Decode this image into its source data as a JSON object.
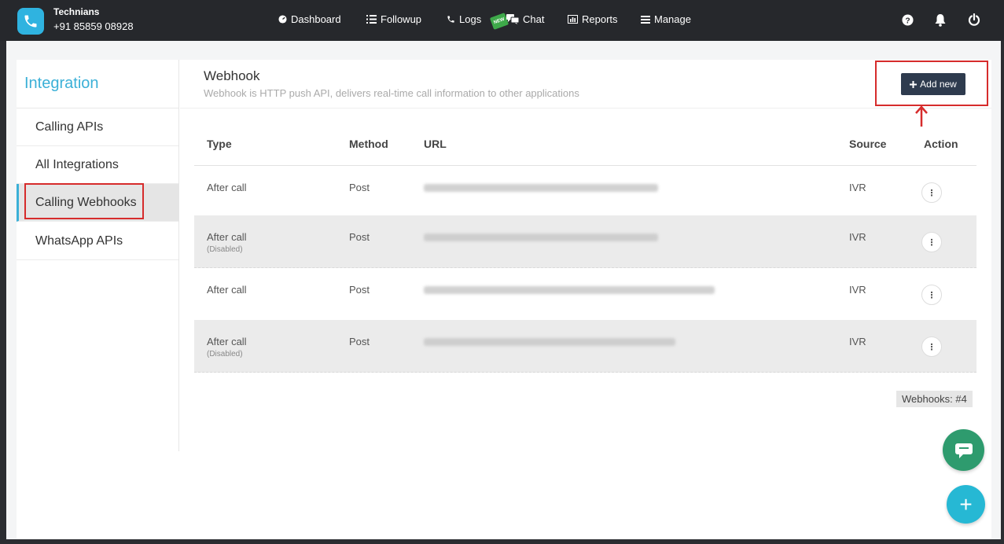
{
  "header": {
    "brand_name": "Technians",
    "brand_phone": "+91 85859 08928",
    "nav": [
      {
        "label": "Dashboard",
        "icon": "dashboard-icon"
      },
      {
        "label": "Followup",
        "icon": "list-icon"
      },
      {
        "label": "Logs",
        "icon": "phone-icon"
      },
      {
        "label": "Chat",
        "icon": "chat-icon",
        "badge": "NEW"
      },
      {
        "label": "Reports",
        "icon": "bar-chart-icon"
      },
      {
        "label": "Manage",
        "icon": "menu-icon"
      }
    ],
    "right_icons": [
      "help-icon",
      "bell-icon",
      "power-icon"
    ]
  },
  "sidebar": {
    "title": "Integration",
    "items": [
      {
        "label": "Calling APIs"
      },
      {
        "label": "All Integrations"
      },
      {
        "label": "Calling Webhooks",
        "active": true
      },
      {
        "label": "WhatsApp APIs"
      }
    ]
  },
  "main": {
    "title": "Webhook",
    "subtitle": "Webhook is HTTP push API, delivers real-time call information to other applications",
    "add_button": "Add new",
    "table": {
      "headers": [
        "Type",
        "Method",
        "URL",
        "Source",
        "Action"
      ],
      "rows": [
        {
          "type": "After call",
          "note": "",
          "method": "Post",
          "url": "",
          "source": "IVR",
          "action_icon": "more-vertical-icon"
        },
        {
          "type": "After call",
          "note": "(Disabled)",
          "method": "Post",
          "url": "",
          "source": "IVR",
          "action_icon": "more-vertical-icon"
        },
        {
          "type": "After call",
          "note": "",
          "method": "Post",
          "url": "",
          "source": "IVR",
          "action_icon": "more-vertical-icon"
        },
        {
          "type": "After call",
          "note": "(Disabled)",
          "method": "Post",
          "url": "",
          "source": "IVR",
          "action_icon": "more-vertical-icon"
        }
      ]
    },
    "count_badge": "Webhooks: #4"
  },
  "colors": {
    "topbar": "#26282c",
    "accent": "#3bb0d7",
    "add_button": "#2e3b4e",
    "highlight": "#d62c2c",
    "fab_chat": "#2e9b6e",
    "fab_add": "#26b8d4"
  }
}
